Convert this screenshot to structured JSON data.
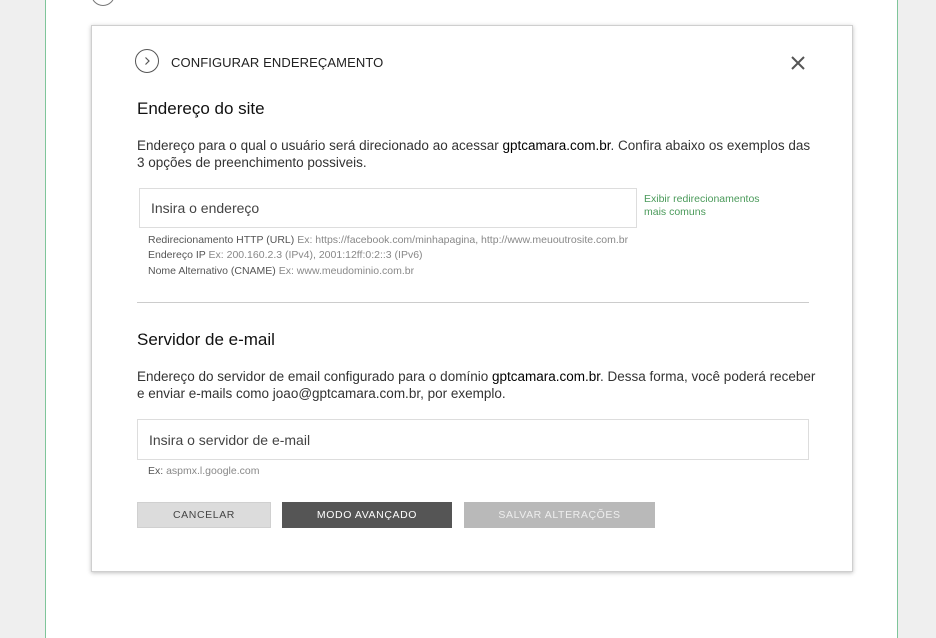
{
  "modal": {
    "title": "CONFIGURAR ENDEREÇAMENTO",
    "close_icon": "close-icon",
    "header_icon": "chevron-right-icon"
  },
  "site": {
    "title": "Endereço do site",
    "desc_pre": "Endereço para o qual o usuário será direcionado ao acessar ",
    "domain": "gptcamara.com.br",
    "desc_post": ". Confira abaixo os exemplos das 3 opções de preenchimento possiveis.",
    "input_placeholder": "Insira o endereço",
    "link_text": "Exibir redirecionamentos mais comuns",
    "hints": [
      {
        "label": "Redirecionamento HTTP (URL)",
        "example": " Ex: https://facebook.com/minhapagina, http://www.meuoutrosite.com.br"
      },
      {
        "label": "Endereço IP",
        "example": " Ex: 200.160.2.3 (IPv4), 2001:12ff:0:2::3 (IPv6)"
      },
      {
        "label": "Nome Alternativo (CNAME)",
        "example": " Ex: www.meudominio.com.br"
      }
    ]
  },
  "email": {
    "title": "Servidor de e-mail",
    "desc_pre": "Endereço do servidor de email configurado para o domínio ",
    "domain": "gptcamara.com.br",
    "desc_post": ". Dessa forma, você poderá receber e enviar e-mails como joao@gptcamara.com.br, por exemplo.",
    "input_placeholder": "Insira o servidor de e-mail",
    "hint_label": "Ex:",
    "hint_example": " aspmx.l.google.com"
  },
  "buttons": {
    "cancel": "CANCELAR",
    "advanced": "MODO AVANÇADO",
    "save": "SALVAR ALTERAÇÕES"
  },
  "colors": {
    "link": "#4a9a5a",
    "advanced_button": "#555555",
    "save_button_disabled": "#b9b9b9",
    "cancel_button": "#dcdcdc"
  }
}
